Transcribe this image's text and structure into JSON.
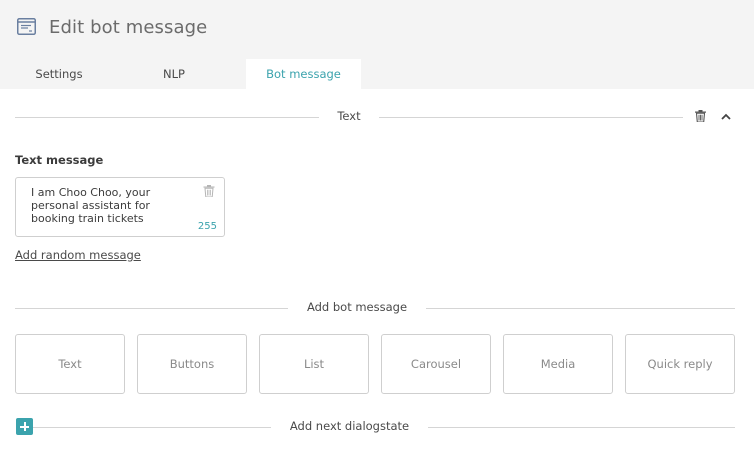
{
  "header": {
    "title": "Edit bot message",
    "icon": "chat-window-icon"
  },
  "tabs": [
    {
      "label": "Settings",
      "active": false
    },
    {
      "label": "NLP",
      "active": false
    },
    {
      "label": "Bot message",
      "active": true
    }
  ],
  "section": {
    "label": "Text"
  },
  "text_message": {
    "label": "Text message",
    "value": "I am Choo Choo, your\npersonal assistant for\nbooking train tickets",
    "char_count": "255"
  },
  "add_random_label": "Add random message",
  "add_bot_message": {
    "label": "Add bot message",
    "types": [
      "Text",
      "Buttons",
      "List",
      "Carousel",
      "Media",
      "Quick reply"
    ]
  },
  "add_next_label": "Add next dialogstate",
  "colors": {
    "accent": "#3ba3ad",
    "header_bg": "#f4f4f4"
  }
}
